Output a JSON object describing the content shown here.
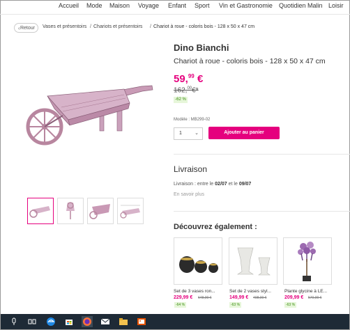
{
  "nav": {
    "items": [
      "Accueil",
      "Mode",
      "Maison",
      "Voyage",
      "Enfant",
      "Sport",
      "Vin et Gastronomie",
      "Quotidien Malin",
      "Loisir"
    ]
  },
  "breadcrumb": {
    "back_label": "Retour",
    "items": [
      "Vases et présentoirs",
      "Chariots et présentoirs",
      "Chariot à roue - coloris bois - 128 x 50 x 47 cm"
    ]
  },
  "product": {
    "brand": "Dino Bianchi",
    "title": "Chariot à roue - coloris bois - 128 x 50 x 47 cm",
    "price_main": "59,",
    "price_cents": "99",
    "price_currency": "€",
    "old_price_main": "162,",
    "old_price_cents": "00",
    "old_price_suffix": "€*",
    "discount": "-62 %",
    "model": "Modèle : MB299-02",
    "quantity": "1",
    "add_to_cart": "Ajouter au panier"
  },
  "delivery": {
    "title": "Livraison",
    "text_prefix": "Livraison : entre le ",
    "date_from": "02/07",
    "text_mid": " et le ",
    "date_to": "09/07",
    "more_link": "En savoir plus"
  },
  "also": {
    "title": "Découvrez également :",
    "items": [
      {
        "name": "Set de 3 vases ron...",
        "price": "229,99 €",
        "old": "648,00 €",
        "disc": "-64 %"
      },
      {
        "name": "Set de 2 vases styl...",
        "price": "149,99 €",
        "old": "408,00 €",
        "disc": "-63 %"
      },
      {
        "name": "Plante glycine à LE...",
        "price": "209,99 €",
        "old": "570,00 €",
        "disc": "-63 %"
      }
    ]
  },
  "colors": {
    "accent": "#e5007e",
    "discount_bg": "#e6f6d9",
    "discount_fg": "#3a8c10",
    "taskbar": "#1e2a36"
  },
  "taskbar": {
    "icons": [
      "search-icon",
      "task-view-icon",
      "edge-icon",
      "store-icon",
      "firefox-icon",
      "mail-icon",
      "file-explorer-icon",
      "photos-icon"
    ]
  }
}
